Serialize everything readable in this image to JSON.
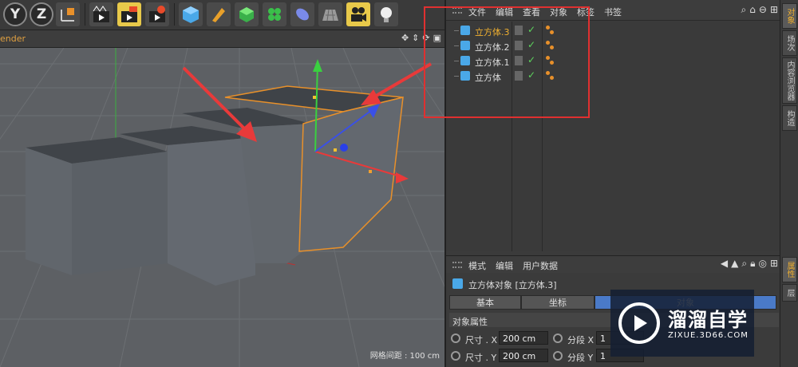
{
  "viewport": {
    "title": "ender",
    "grid_label": "网格间距 : 100 cm"
  },
  "toolbar": {
    "axis_y": "Y",
    "axis_z": "Z"
  },
  "object_manager": {
    "menu": [
      "文件",
      "编辑",
      "查看",
      "对象",
      "标签",
      "书签"
    ],
    "objects": [
      {
        "name": "立方体.3",
        "active": true
      },
      {
        "name": "立方体.2",
        "active": false
      },
      {
        "name": "立方体.1",
        "active": false
      },
      {
        "name": "立方体",
        "active": false
      }
    ]
  },
  "attributes": {
    "menu": [
      "模式",
      "编辑",
      "用户数据"
    ],
    "title": "立方体对象 [立方体.3]",
    "tabs": [
      "基本",
      "坐标",
      "对象"
    ],
    "section": "对象属性",
    "fields": [
      {
        "label": "尺寸 . X",
        "value": "200 cm",
        "seg_label": "分段 X",
        "seg_value": "1"
      },
      {
        "label": "尺寸 . Y",
        "value": "200 cm",
        "seg_label": "分段 Y",
        "seg_value": "1"
      }
    ]
  },
  "side_tabs": [
    "对象",
    "场次",
    "内容浏览器",
    "构造",
    "属性",
    "层"
  ],
  "watermark": {
    "title": "溜溜自学",
    "subtitle": "ZIXUE.3D66.COM"
  },
  "colors": {
    "accent": "#f0b030",
    "highlight_box": "#e03030",
    "arrow": "#e83a3a"
  }
}
